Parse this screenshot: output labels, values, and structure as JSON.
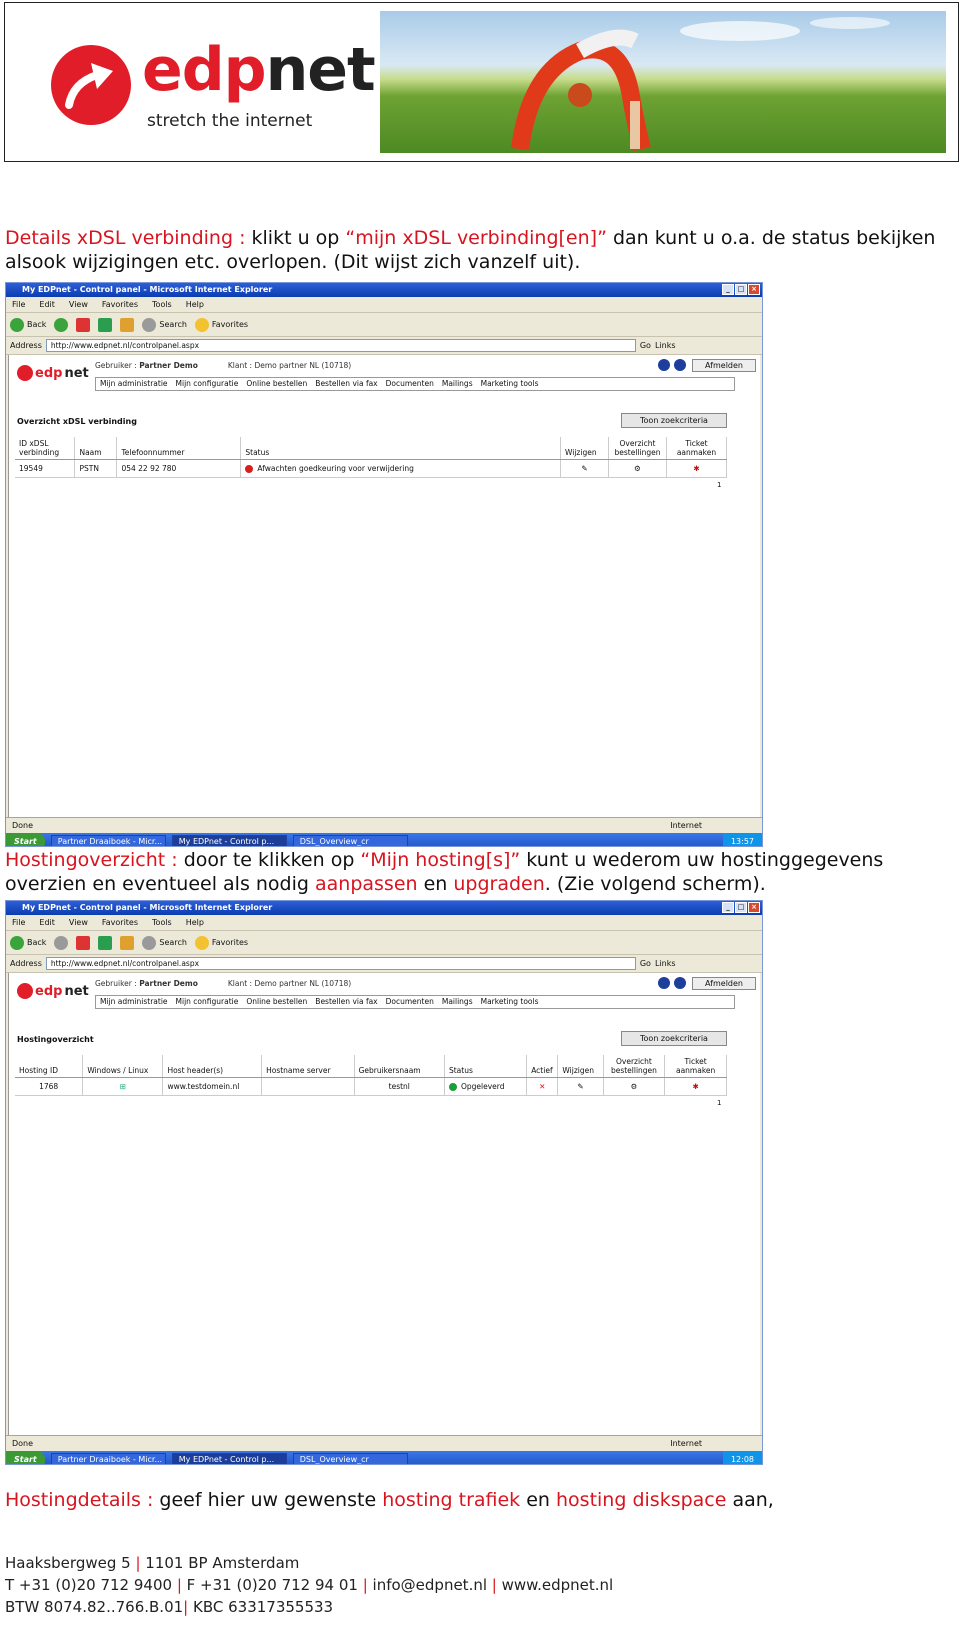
{
  "brand": {
    "name_red": "edp",
    "name_dark": "net",
    "tagline": "stretch the internet",
    "red_hex": "#e11d2a"
  },
  "section1": {
    "heading": "Details xDSL verbinding :",
    "text_a": " klikt u op ",
    "link": "“mijn xDSL verbinding[en]”",
    "text_b": " dan kunt u o.a. de status bekijken alsook wijzigingen etc. overlopen. (Dit wijst zich vanzelf uit)."
  },
  "browser1": {
    "title": "My EDPnet - Control panel - Microsoft Internet Explorer",
    "menu": [
      "File",
      "Edit",
      "View",
      "Favorites",
      "Tools",
      "Help"
    ],
    "toolbar": {
      "back": "Back",
      "search": "Search",
      "favorites": "Favorites"
    },
    "address_label": "Address",
    "address": "http://www.edpnet.nl/controlpanel.aspx",
    "go": "Go",
    "links": "Links",
    "user_label": "Gebruiker :",
    "user": "Partner Demo",
    "client_label": "Klant :",
    "client": "Demo partner NL (10718)",
    "logout": "Afmelden",
    "nav": [
      "Mijn administratie",
      "Mijn configuratie",
      "Online bestellen",
      "Bestellen via fax",
      "Documenten",
      "Mailings",
      "Marketing tools"
    ],
    "section_title": "Overzicht xDSL verbinding",
    "search_btn": "Toon zoekcriteria",
    "columns": [
      "ID xDSL verbinding",
      "Naam",
      "Telefoonnummer",
      "Status",
      "Wijzigen",
      "Overzicht bestellingen",
      "Ticket aanmaken"
    ],
    "row": {
      "id": "19549",
      "naam": "PSTN",
      "tel": "054 22 92 780",
      "status": "Afwachten goedkeuring voor verwijdering"
    },
    "page": "1",
    "status": "Done",
    "zone": "Internet",
    "taskbar": {
      "start": "Start",
      "task1": "Partner Draaiboek - Micr...",
      "task2": "My EDPnet - Control p...",
      "task3": "DSL_Overview_cr",
      "time": "13:57"
    }
  },
  "section2": {
    "heading": "Hostingoverzicht :",
    "text_a": " door te klikken op ",
    "link": "“Mijn hosting[s]”",
    "text_b": " kunt u wederom uw hostinggegevens overzien en eventueel als nodig ",
    "word1": "aanpassen",
    "text_c": " en ",
    "word2": "upgraden",
    "text_d": ". (Zie volgend scherm)."
  },
  "browser2": {
    "title": "My EDPnet - Control panel - Microsoft Internet Explorer",
    "address": "http://www.edpnet.nl/controlpanel.aspx",
    "section_title": "Hostingoverzicht",
    "search_btn": "Toon zoekcriteria",
    "columns": [
      "Hosting ID",
      "Windows / Linux",
      "Host header(s)",
      "Hostname server",
      "Gebruikersnaam",
      "Status",
      "Actief",
      "Wijzigen",
      "Overzicht bestellingen",
      "Ticket aanmaken"
    ],
    "row": {
      "id": "1768",
      "host": "www.testdomein.nl",
      "user": "testnl",
      "status": "Opgeleverd"
    },
    "page": "1",
    "status": "Done",
    "zone": "Internet",
    "taskbar": {
      "start": "Start",
      "task1": "Partner Draaiboek - Micr...",
      "task2": "My EDPnet - Control p...",
      "task3": "DSL_Overview_cr",
      "time": "12:08"
    }
  },
  "section3": {
    "heading": "Hostingdetails :",
    "text_a": " geef hier uw gewenste ",
    "word1": "hosting trafiek",
    "text_b": " en ",
    "word2": "hosting diskspace",
    "text_c": " aan,"
  },
  "footer": {
    "line1a": "Haaksbergweg 5",
    "line1b": "1101 BP Amsterdam",
    "line2a": "T +31 (0)20 712 9400",
    "line2b": "F +31 (0)20 712 94 01",
    "line2c": "info@edpnet.nl",
    "line2d": "www.edpnet.nl",
    "line3a": "BTW 8074.82..766.B.01",
    "line3b": "KBC 63317355533"
  }
}
